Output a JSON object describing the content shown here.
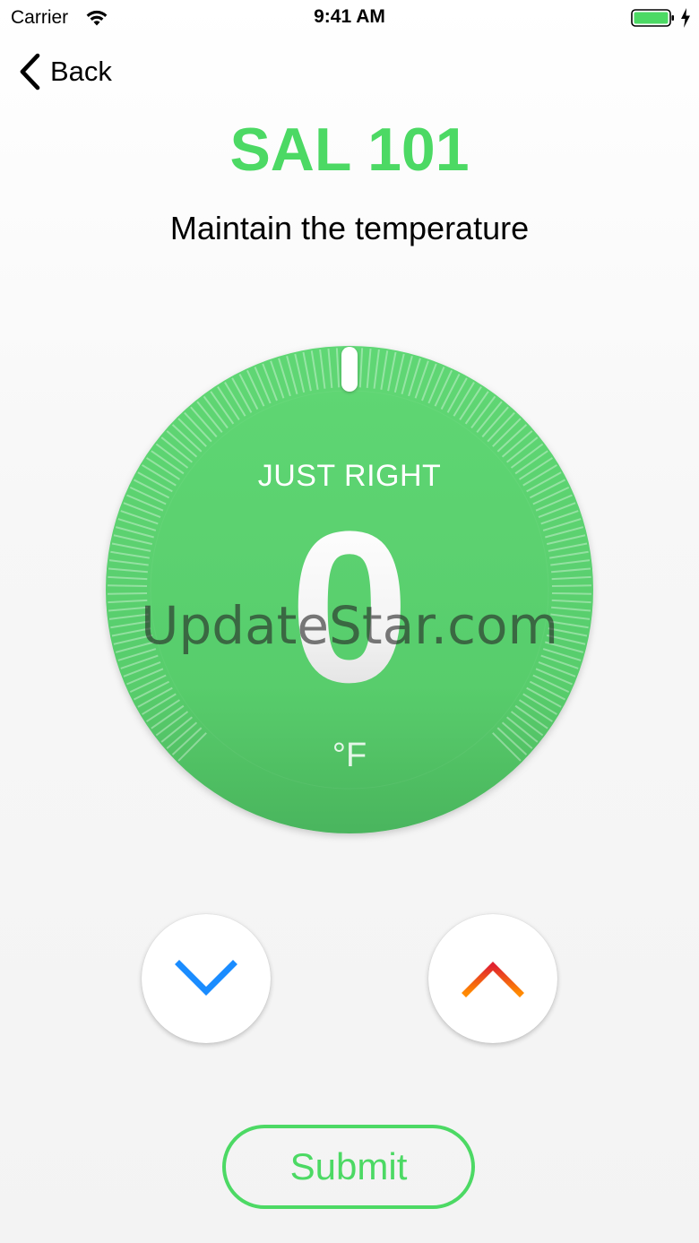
{
  "status_bar": {
    "carrier": "Carrier",
    "time": "9:41 AM",
    "wifi_icon": "wifi-icon",
    "battery_icon": "battery-icon",
    "charging_icon": "bolt-icon",
    "battery_color": "#4cd964"
  },
  "nav": {
    "back_label": "Back",
    "back_icon": "chevron-left-icon"
  },
  "header": {
    "title": "SAL 101",
    "subtitle": "Maintain the temperature"
  },
  "dial": {
    "status": "JUST RIGHT",
    "value": "0",
    "unit": "°F",
    "color": "#5cd16f"
  },
  "watermark": "UpdateStar.com",
  "controls": {
    "decrease_icon": "chevron-down-icon",
    "increase_icon": "chevron-up-icon",
    "decrease_color": "#1a8cff",
    "increase_color_start": "#ff8a00",
    "increase_color_end": "#e0232f"
  },
  "submit_label": "Submit",
  "colors": {
    "accent": "#4cd964"
  }
}
